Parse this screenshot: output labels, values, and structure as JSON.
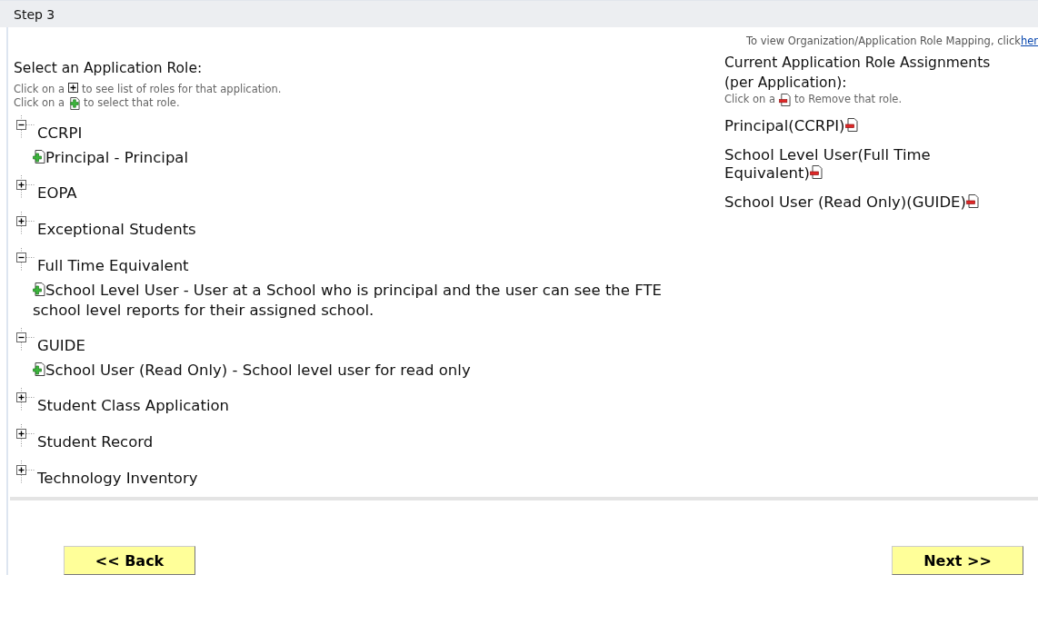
{
  "header": {
    "title": "Step 3"
  },
  "mapping_note": {
    "text": "To view Organization/Application Role Mapping, click",
    "link": "her"
  },
  "select_panel": {
    "title": "Select an Application Role:",
    "hint_expand": [
      "Click on a",
      "to see list of roles for that application."
    ],
    "hint_select": [
      "Click on a",
      "to select that role."
    ]
  },
  "applications": [
    {
      "name": "CCRPI",
      "expanded": true,
      "children": [
        {
          "label": "Principal - Principal"
        }
      ]
    },
    {
      "name": "EOPA",
      "expanded": false
    },
    {
      "name": "Exceptional Students",
      "expanded": false
    },
    {
      "name": "Full Time Equivalent",
      "expanded": true,
      "children": [
        {
          "label": "School Level User - User at a School who is principal and the user can see the FTE school level reports for their assigned school."
        }
      ]
    },
    {
      "name": "GUIDE",
      "expanded": true,
      "children": [
        {
          "label": "School User (Read Only) - School level user for read only"
        }
      ]
    },
    {
      "name": "Student Class Application",
      "expanded": false
    },
    {
      "name": "Student Record",
      "expanded": false
    },
    {
      "name": "Technology Inventory",
      "expanded": false
    }
  ],
  "assignments_panel": {
    "title": "Current Application Role Assignments (per Application):",
    "hint": [
      "Click on a",
      "to Remove that role."
    ],
    "items": [
      {
        "label": "Principal(CCRPI)"
      },
      {
        "label": "School Level User(Full Time Equivalent)"
      },
      {
        "label": "School User (Read Only)(GUIDE)"
      }
    ]
  },
  "buttons": {
    "back": "<< Back",
    "next": "Next >>"
  }
}
